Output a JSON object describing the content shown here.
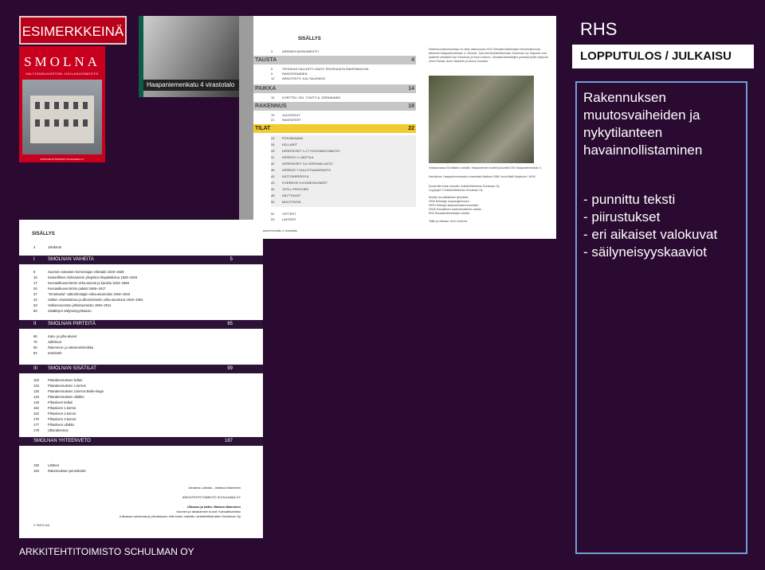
{
  "tag": "ESIMERKKEINÄ",
  "cover1": {
    "brand": "SMOLNA",
    "subtitle": "VALTIONEUVOSTON JUHLAHUONEISTO",
    "footer": "ARKKITEHTITOIMISTO SCHULMAN OY"
  },
  "cover2": {
    "strip": "Haapaniemenkatu 4 virastotalo"
  },
  "toc2": {
    "title": "SISÄLLYS",
    "sections": [
      {
        "label": "TAUSTA",
        "page": "4"
      },
      {
        "label": "PAIKKA",
        "page": "14"
      },
      {
        "label": "RAKENNUS",
        "page": "18"
      },
      {
        "label": "TILAT",
        "page": "22"
      }
    ],
    "rows_a": [
      {
        "n": "3",
        "t": "ARKINEN MONUMENTTI"
      }
    ],
    "rows_b": [
      {
        "n": "5",
        "t": "TEHOKAS HALLINTO VAATII TEHOKKAITA RAKENNUKSIA"
      },
      {
        "n": "9",
        "t": "RAKENTAMINEN"
      },
      {
        "n": "12",
        "t": "ARKKITEHTI, KAJ SALENIUS"
      }
    ],
    "rows_c": [
      {
        "n": "15",
        "t": "KORTTELI 291, TONTTI 6, SÖRNÄINEN"
      }
    ],
    "rows_d": [
      {
        "n": "19",
        "t": "JULKISIVUT"
      },
      {
        "n": "21",
        "t": "RAKENTEET"
      }
    ],
    "rows_e": [
      {
        "n": "24",
        "t": "POHJAKAAVA"
      },
      {
        "n": "26",
        "t": "KELLARIT"
      },
      {
        "n": "28",
        "t": "KERROKSET 1-2 TYÖVOIMATOIMISTO"
      },
      {
        "n": "31",
        "t": "KERROS 1 LIIKETILA"
      },
      {
        "n": "32",
        "t": "KERROKSET 3-6 VEROHALLINTO"
      },
      {
        "n": "36",
        "t": "KERROS 7 KULUTTAJAVIRASTO"
      },
      {
        "n": "40",
        "t": "KATTOKERROS 8"
      },
      {
        "n": "43",
        "t": "9 KERROS IV-KONEHUONEET"
      },
      {
        "n": "44",
        "t": "1970-L PINTOJEN"
      },
      {
        "n": "48",
        "t": "KÄYTTÄVÄT"
      },
      {
        "n": "50",
        "t": "MUUTOKSIA"
      }
    ],
    "rows_f": [
      {
        "n": "52",
        "t": "VIITTEET"
      },
      {
        "n": "53",
        "t": "LÄHTEET"
      }
    ],
    "intro": "Rakennushistoriaselvitys on tehty aikavuosina 2013 Senaatti-kiinteistöjen toimeksiannosta kiinteistö Haapaniemenkatu 4, Helsinki. Työn teki Arkkitehtitoimisto Schulman Oy. Raportin ovat laatineet arkkitehti Sari Schulman ja Kirsi Lindroos. Senaatti-kiinteistöjen puolesta työtä ohjasivat Jenni Pahola, Anne Saarinen ja Noora Vuorinen.",
    "caption": "Viistokuvassa Sörnäisten rantatie, Haapaniemen kortteli ja kortteli 291 Haapaniemenkatu 4.",
    "copyright": "Kansikuva: Haapaniemenkadun virastotalo tilattuna 1986, kuva Matti Karjaluoto / HKM",
    "credits": [
      "Kuvat ellei toisin mainittu: Arkkitehtitoimisto Schulman Oy",
      "Copyright © Arkkitehtitoimisto Schulman Oy",
      "Muiden kuvalähteiden lyhenteet:",
      "HKM Helsingin kaupunginmuseo",
      "HKR Helsingin kaupunkirakennusvirasto",
      "KAVA Kansallinen audiovisuaalinen arkisto",
      "SKA Senaatti-kiinteistöjen arkisto"
    ],
    "layout": "Taitto ja ulkoasu: Kirsi Lindroos",
    "page": "2   Haapaniemenkatu 4 virastotalo"
  },
  "toc1": {
    "title": "SISÄLLYS",
    "intro": {
      "n": "4",
      "t": "Johdanto"
    },
    "sections": [
      {
        "n": "I",
        "t": "SMOLNAN VAIHEITA",
        "p": "5"
      },
      {
        "n": "II",
        "t": "SMOLNAN PIIRTEITÄ",
        "p": "65"
      },
      {
        "n": "III",
        "t": "SMOLNAN SISÄTILAT",
        "p": "99"
      },
      {
        "n": "",
        "t": "SMOLNAN YHTEENVETO",
        "p": "187"
      }
    ],
    "rows_i": [
      {
        "n": "6",
        "t": "Suomen sotaväen komentajan virkatalo 1819–1828"
      },
      {
        "n": "15",
        "t": "Keisarillisen Aleksanterin yliopiston tilapäistiloina 1828–1833"
      },
      {
        "n": "17",
        "t": "Kenraalikuvernöörin virka-asunto ja kanslia 1833–1866"
      },
      {
        "n": "26",
        "t": "Kenraalikuvernöörin palatsi 1866–1917"
      },
      {
        "n": "37",
        "t": "\"Smolnasta\" valtionhoitajan virka-asunnoksi 1918–1919"
      },
      {
        "n": "42",
        "t": "Valtion virastotalona ja ulkoministerin virka-asuntona 1919–1964"
      },
      {
        "n": "53",
        "t": "Valtioneuvoston juhlahuoneisto 1964–2011"
      },
      {
        "n": "60",
        "t": "Sisätilojen säilyneisyyskaavio"
      }
    ],
    "rows_ii": [
      {
        "n": "66",
        "t": "Katu- ja piha-alueet"
      },
      {
        "n": "70",
        "t": "Julkisivut"
      },
      {
        "n": "80",
        "t": "Rakennus- ja rakennetekniikka"
      },
      {
        "n": "84",
        "t": "Interiöörit"
      }
    ],
    "rows_iii": [
      {
        "n": "102",
        "t": "Päärakennuksen kellari"
      },
      {
        "n": "104",
        "t": "Päärakennuksen 1.kerros"
      },
      {
        "n": "126",
        "t": "Päärakennuksen 2.kerros Belle-étage"
      },
      {
        "n": "143",
        "t": "Päärakennuksen ullakko"
      },
      {
        "n": "146",
        "t": "Pihasiiven kellari"
      },
      {
        "n": "152",
        "t": "Pihasiiven 1.kerros"
      },
      {
        "n": "162",
        "t": "Pihasiiven 2.kerros"
      },
      {
        "n": "170",
        "t": "Pihasiiven 3.kerros"
      },
      {
        "n": "177",
        "t": "Pihasiiven ullakko"
      },
      {
        "n": "178",
        "t": "Ulkorakennus"
      }
    ],
    "rows_end": [
      {
        "n": "192",
        "t": "Lähteet"
      },
      {
        "n": "194",
        "t": "Rakennuksen perustiedot"
      }
    ],
    "authors": "Johanna Luhtala – Markus Manninen",
    "office": "ARKKITEHTITOIMISTO SCHULMAN OY",
    "credit1": "Ulkoasu ja taitto: Markus Manninen",
    "credit2": "Kannen ja takakannen kuvat: Kansallisarkisto",
    "credit3": "Julkaisun valokuvat ja piirustukset, ellei toisin mainittu: Arkkitehtitoimisto Schulman Oy",
    "page": "2     SMOLNA"
  },
  "rhs": "RHS",
  "subhead": "LOPPUTULOS / JULKAISU",
  "lead": "Rakennuksen muutosvaiheiden ja nykytilanteen havainnollistaminen",
  "bullets": [
    "- punnittu teksti",
    "- piirustukset",
    "- eri aikaiset valokuvat",
    "- säilyneisyyskaaviot"
  ],
  "footer": "ARKKITEHTITOIMISTO SCHULMAN OY"
}
